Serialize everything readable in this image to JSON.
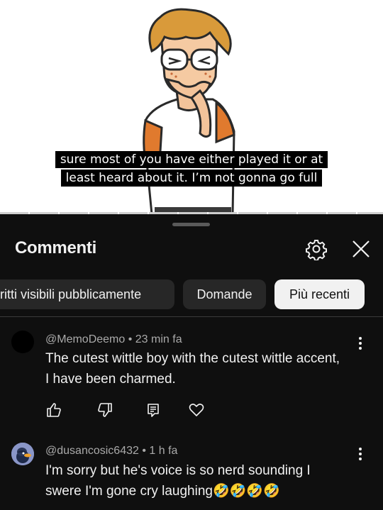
{
  "video": {
    "caption_line1": "sure most of you have either played it or at",
    "caption_line2": "least heard about it. I’m not gonna go full"
  },
  "comments_panel": {
    "title": "Commenti",
    "icons": {
      "settings": "gear-icon",
      "close": "close-icon"
    },
    "chips": [
      {
        "label": "ritti visibili pubblicamente",
        "selected": false
      },
      {
        "label": "Domande",
        "selected": false
      },
      {
        "label": "Più recenti",
        "selected": true
      }
    ]
  },
  "comments": [
    {
      "author": "@MemoDeemo",
      "separator": " • ",
      "time": "23 min fa",
      "text": "The cutest wittle boy with the cutest wittle accent, I have been charmed.",
      "actions": [
        "thumbs-up-icon",
        "thumbs-down-icon",
        "reply-icon",
        "heart-icon"
      ]
    },
    {
      "author": "@dusancosic6432",
      "separator": " • ",
      "time": "1 h fa",
      "text": "I'm sorry but he's voice is so nerd sounding I swere I'm gone cry laughing🤣🤣🤣🤣"
    }
  ],
  "colors": {
    "sheet_bg": "#0f0f0f",
    "chip_bg": "#272727",
    "chip_selected_bg": "#f1f1f1",
    "text_primary": "#f1f1f1",
    "text_secondary": "#aaaaaa"
  }
}
